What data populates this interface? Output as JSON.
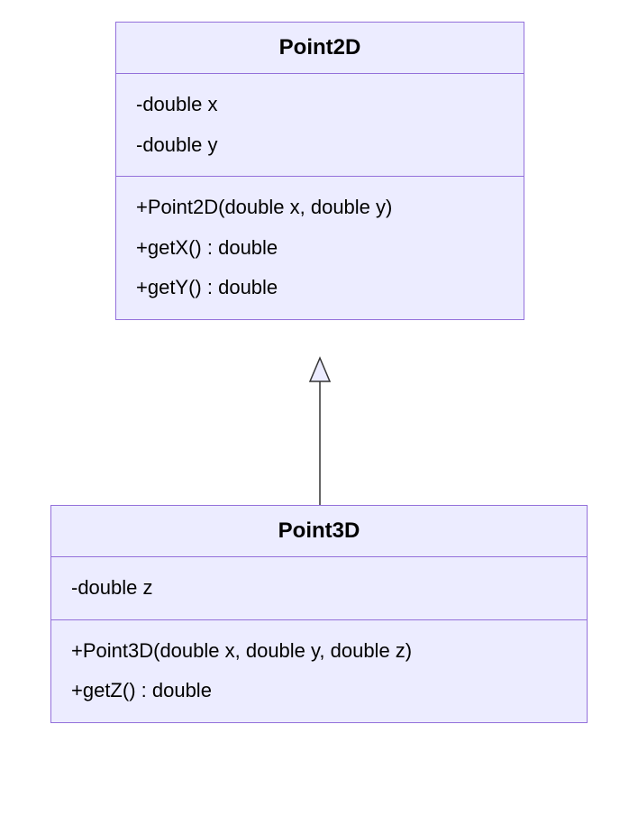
{
  "classes": {
    "point2d": {
      "name": "Point2D",
      "attributes": [
        "-double x",
        "-double y"
      ],
      "methods": [
        "+Point2D(double x, double y)",
        "+getX() : double",
        "+getY() : double"
      ]
    },
    "point3d": {
      "name": "Point3D",
      "attributes": [
        "-double z"
      ],
      "methods": [
        "+Point3D(double x, double y, double z)",
        "+getZ() : double"
      ]
    }
  },
  "relationship": {
    "type": "inheritance",
    "from": "Point3D",
    "to": "Point2D"
  }
}
